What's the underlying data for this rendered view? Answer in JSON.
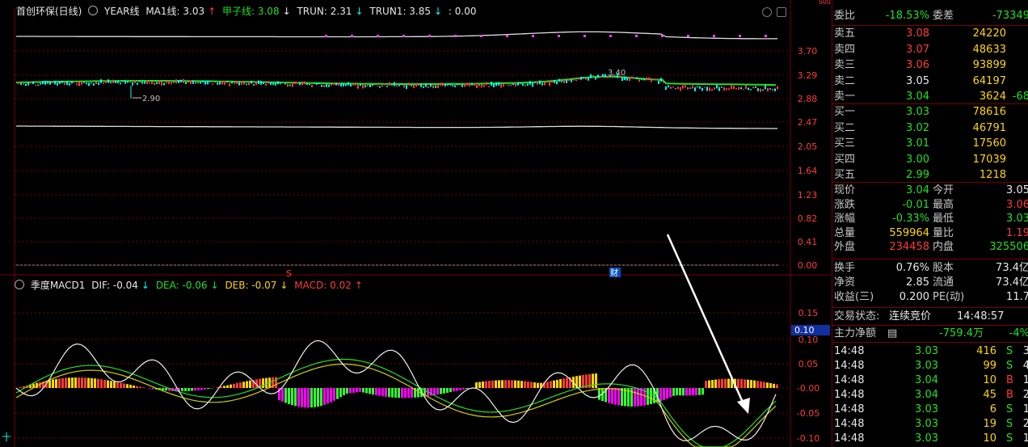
{
  "top_header": {
    "stock_name": "首创环保(日线)",
    "year_label": "YEAR线",
    "ma1_label": "MA1线: 3.03",
    "jiazi_label": "甲子线: 3.08",
    "trun_label": "TRUN: 2.31",
    "trun1_label": "TRUN1: 3.85",
    "extra_label": ": 0.00"
  },
  "price_axis": [
    "3.70",
    "3.29",
    "2.88",
    "2.47",
    "2.05",
    "1.64",
    "1.23",
    "0.82",
    "0.41",
    "0.00"
  ],
  "price_annotations": {
    "high": "3.40",
    "low": "2.90",
    "marker_s": "S",
    "marker_cai": "财",
    "top_value": "500"
  },
  "macd_header": {
    "name": "季度MACD1",
    "dif": "DIF: -0.04",
    "dea": "DEA: -0.06",
    "deb": "DEB: -0.07",
    "macd": "MACD: 0.02"
  },
  "macd_axis": [
    "0.15",
    "0.10",
    "0.05",
    "-0.00",
    "-0.05",
    "-0.10"
  ],
  "macd_highlight": "0.10",
  "cursor_symbol": "十",
  "quote": {
    "weibi": {
      "label": "委比",
      "value": "-18.53%",
      "label2": "委差",
      "value2": "-73349"
    },
    "asks": [
      {
        "label": "卖五",
        "price": "3.08",
        "vol": "24220",
        "chg": ""
      },
      {
        "label": "卖四",
        "price": "3.07",
        "vol": "48633",
        "chg": ""
      },
      {
        "label": "卖三",
        "price": "3.06",
        "vol": "93899",
        "chg": ""
      },
      {
        "label": "卖二",
        "price": "3.05",
        "vol": "64197",
        "chg": ""
      },
      {
        "label": "卖一",
        "price": "3.04",
        "vol": "3624",
        "chg": "-68"
      }
    ],
    "bids": [
      {
        "label": "买一",
        "price": "3.03",
        "vol": "78616"
      },
      {
        "label": "买二",
        "price": "3.02",
        "vol": "46791"
      },
      {
        "label": "买三",
        "price": "3.01",
        "vol": "17560"
      },
      {
        "label": "买四",
        "price": "3.00",
        "vol": "17039"
      },
      {
        "label": "买五",
        "price": "2.99",
        "vol": "1218"
      }
    ],
    "stats": [
      {
        "l1": "现价",
        "v1": "3.04",
        "l2": "今开",
        "v2": "3.05"
      },
      {
        "l1": "涨跌",
        "v1": "-0.01",
        "l2": "最高",
        "v2": "3.06"
      },
      {
        "l1": "涨幅",
        "v1": "-0.33%",
        "l2": "最低",
        "v2": "3.03"
      },
      {
        "l1": "总量",
        "v1": "559964",
        "l2": "量比",
        "v2": "1.19"
      },
      {
        "l1": "外盘",
        "v1": "234458",
        "l2": "内盘",
        "v2": "325506"
      }
    ],
    "fund": [
      {
        "l1": "换手",
        "v1": "0.76%",
        "l2": "股本",
        "v2": "73.4亿"
      },
      {
        "l1": "净资",
        "v1": "2.85",
        "l2": "流通",
        "v2": "73.4亿"
      },
      {
        "l1": "收益(三)",
        "v1": "0.200",
        "l2": "PE(动)",
        "v2": "11.7"
      }
    ],
    "trade_status": {
      "label": "交易状态:",
      "value": "连续竞价",
      "time": "14:48:57"
    },
    "main_flow": {
      "label": "主力净额",
      "value": "-759.4万",
      "pct": "-4%"
    },
    "ticks": [
      {
        "time": "14:48",
        "price": "3.03",
        "vol": "416",
        "side": "S",
        "n": "3"
      },
      {
        "time": "14:48",
        "price": "3.03",
        "vol": "99",
        "side": "S",
        "n": "4"
      },
      {
        "time": "14:48",
        "price": "3.04",
        "vol": "10",
        "side": "B",
        "n": "1"
      },
      {
        "time": "14:48",
        "price": "3.04",
        "vol": "45",
        "side": "B",
        "n": "2"
      },
      {
        "time": "14:48",
        "price": "3.03",
        "vol": "6",
        "side": "S",
        "n": "1"
      },
      {
        "time": "14:48",
        "price": "3.03",
        "vol": "19",
        "side": "S",
        "n": "2"
      },
      {
        "time": "14:48",
        "price": "3.03",
        "vol": "10",
        "side": "S",
        "n": "1"
      }
    ]
  },
  "colors": {
    "up": "#ff3b3b",
    "down": "#22e022",
    "macd_pos_yellow": "#ffd700",
    "macd_neg_magenta": "#ff00ff"
  }
}
